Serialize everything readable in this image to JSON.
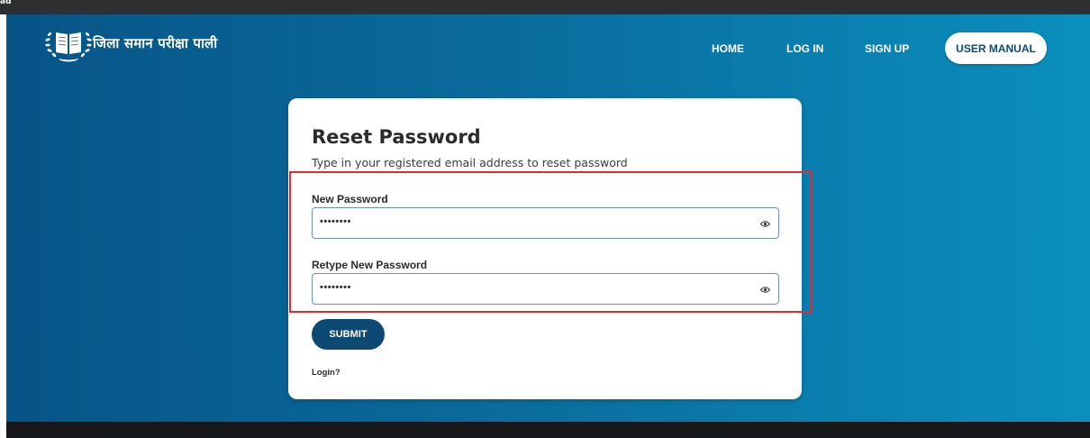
{
  "top_strip": {
    "text": "ad"
  },
  "brand": {
    "name": "जिला समान परीक्षा पाली",
    "logo_icon": "open-book-laurel-icon"
  },
  "nav": {
    "home": "HOME",
    "login": "LOG IN",
    "signup": "SIGN UP",
    "manual": "USER MANUAL"
  },
  "card": {
    "title": "Reset Password",
    "subtitle": "Type in your registered email address to reset password",
    "new_password": {
      "label": "New Password",
      "value": "••••••••",
      "icon": "eye-icon"
    },
    "retype_password": {
      "label": "Retype New Password",
      "value": "••••••••",
      "icon": "eye-icon"
    },
    "submit": "SUBMIT",
    "login_link": "Login?"
  },
  "colors": {
    "hero_start": "#075487",
    "hero_end": "#0a8fbd",
    "button": "#0c4973",
    "highlight": "#e8282b"
  }
}
